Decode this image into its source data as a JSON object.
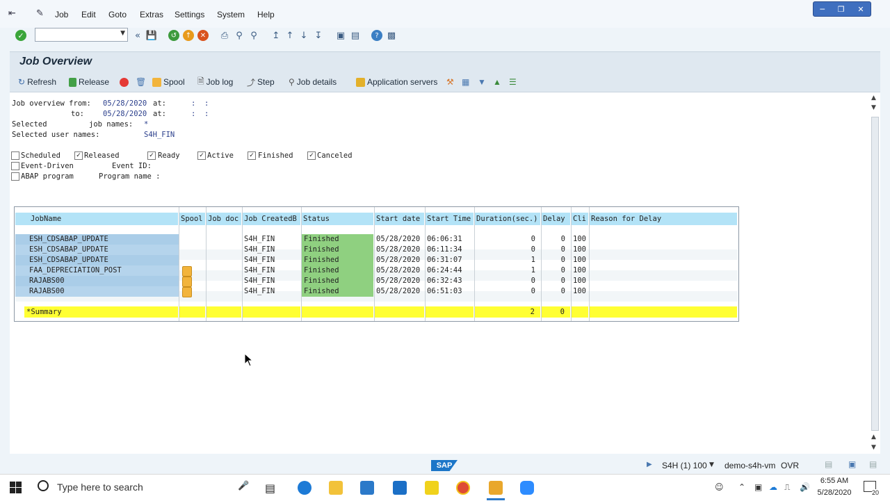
{
  "menu": {
    "items": [
      "Job",
      "Edit",
      "Goto",
      "Extras",
      "Settings",
      "System",
      "Help"
    ]
  },
  "page": {
    "title": "Job Overview"
  },
  "app_toolbar": {
    "refresh": "Refresh",
    "release": "Release",
    "spool": "Spool",
    "job_log": "Job log",
    "step": "Step",
    "job_details": "Job details",
    "app_servers": "Application servers"
  },
  "criteria": {
    "from_label": "Job overview from:",
    "from_date": "05/28/2020",
    "at_label": "at:",
    "time_sep": ":  :",
    "to_label": "to:",
    "to_date": "05/28/2020",
    "selected_label": "Selected",
    "job_names_label": "job names:",
    "job_names_value": "*",
    "user_names_label": "Selected user names:",
    "user_names_value": "S4H_FIN"
  },
  "filters": {
    "scheduled": "Scheduled",
    "released": "Released",
    "ready": "Ready",
    "active": "Active",
    "finished": "Finished",
    "canceled": "Canceled",
    "event_driven": "Event-Driven",
    "event_id": "Event ID:",
    "abap_program": "ABAP program",
    "program_name": "Program name :"
  },
  "table": {
    "headers": [
      "JobName",
      "Spool",
      "Job doc",
      "Job CreatedB",
      "Status",
      "Start date",
      "Start Time",
      "Duration(sec.)",
      "Delay",
      "Cli",
      "Reason for Delay"
    ],
    "rows": [
      {
        "job": "ESH_CDSABAP_UPDATE",
        "created": "S4H_FIN",
        "status": "Finished",
        "date": "05/28/2020",
        "time": "06:06:31",
        "duration": "0",
        "delay": "0",
        "cli": "100"
      },
      {
        "job": "ESH_CDSABAP_UPDATE",
        "created": "S4H_FIN",
        "status": "Finished",
        "date": "05/28/2020",
        "time": "06:11:34",
        "duration": "0",
        "delay": "0",
        "cli": "100"
      },
      {
        "job": "ESH_CDSABAP_UPDATE",
        "created": "S4H_FIN",
        "status": "Finished",
        "date": "05/28/2020",
        "time": "06:31:07",
        "duration": "1",
        "delay": "0",
        "cli": "100"
      },
      {
        "job": "FAA_DEPRECIATION_POST",
        "created": "S4H_FIN",
        "status": "Finished",
        "date": "05/28/2020",
        "time": "06:24:44",
        "duration": "1",
        "delay": "0",
        "cli": "100"
      },
      {
        "job": "RAJABS00",
        "created": "S4H_FIN",
        "status": "Finished",
        "date": "05/28/2020",
        "time": "06:32:43",
        "duration": "0",
        "delay": "0",
        "cli": "100"
      },
      {
        "job": "RAJABS00",
        "created": "S4H_FIN",
        "status": "Finished",
        "date": "05/28/2020",
        "time": "06:51:03",
        "duration": "0",
        "delay": "0",
        "cli": "100"
      }
    ],
    "summary": {
      "label": "*Summary",
      "duration": "2",
      "delay": "0"
    }
  },
  "statusbar": {
    "system": "S4H (1) 100",
    "server": "demo-s4h-vm",
    "mode": "OVR"
  },
  "taskbar": {
    "search_placeholder": "Type here to search",
    "time": "6:55 AM",
    "date": "5/28/2020",
    "notif_count": "20"
  },
  "colors": {
    "header_blue": "#b3e3f7",
    "status_green": "#8fd080",
    "summary_yellow": "#ffff33",
    "job_cell_blue": "#aacde8"
  }
}
